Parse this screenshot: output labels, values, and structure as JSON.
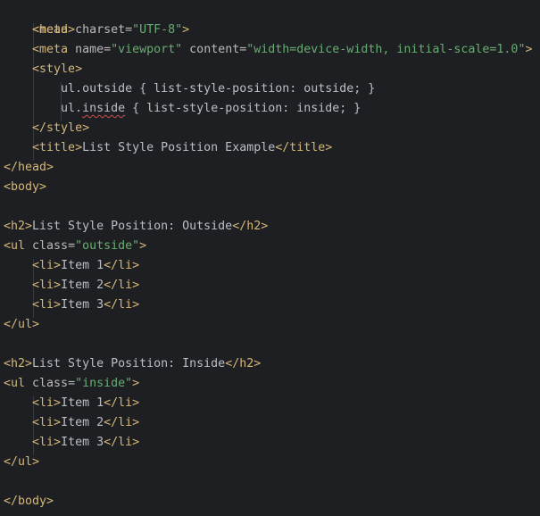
{
  "colors": {
    "background": "#1e1f22",
    "tag": "#d5b778",
    "attribute": "#bababa",
    "string": "#6aab73",
    "text": "#bcbec4"
  },
  "code": {
    "l1_tag": "<head>",
    "l2_open": "<meta",
    "l2_attr": " charset=",
    "l2_val": "\"UTF-8\"",
    "l2_close": ">",
    "l3_open": "<meta",
    "l3_attr1": " name=",
    "l3_val1": "\"viewport\"",
    "l3_attr2": " content=",
    "l3_val2": "\"width=device-width, initial-scale=1.0\"",
    "l3_close": ">",
    "l4_tag": "<style>",
    "l5_sel": "ul.outside",
    "l5_rule": " { list-style-position: outside; }",
    "l6_sel_a": "ul.",
    "l6_sel_b": "inside",
    "l6_rule": " { list-style-position: inside; }",
    "l7_tag": "</style>",
    "l8_open": "<title>",
    "l8_text": "List Style Position Example",
    "l8_close": "</title>",
    "l9_tag": "</head>",
    "l10_tag": "<body>",
    "l12_open": "<h2>",
    "l12_text": "List Style Position: Outside",
    "l12_close": "</h2>",
    "l13_open": "<ul",
    "l13_attr": " class=",
    "l13_val": "\"outside\"",
    "l13_close": ">",
    "l14_open": "<li>",
    "l14_text": "Item 1",
    "l14_close": "</li>",
    "l15_open": "<li>",
    "l15_text": "Item 2",
    "l15_close": "</li>",
    "l16_open": "<li>",
    "l16_text": "Item 3",
    "l16_close": "</li>",
    "l17_tag": "</ul>",
    "l19_open": "<h2>",
    "l19_text": "List Style Position: Inside",
    "l19_close": "</h2>",
    "l20_open": "<ul",
    "l20_attr": " class=",
    "l20_val": "\"inside\"",
    "l20_close": ">",
    "l21_open": "<li>",
    "l21_text": "Item 1",
    "l21_close": "</li>",
    "l22_open": "<li>",
    "l22_text": "Item 2",
    "l22_close": "</li>",
    "l23_open": "<li>",
    "l23_text": "Item 3",
    "l23_close": "</li>",
    "l24_tag": "</ul>",
    "l26_tag": "</body>"
  }
}
